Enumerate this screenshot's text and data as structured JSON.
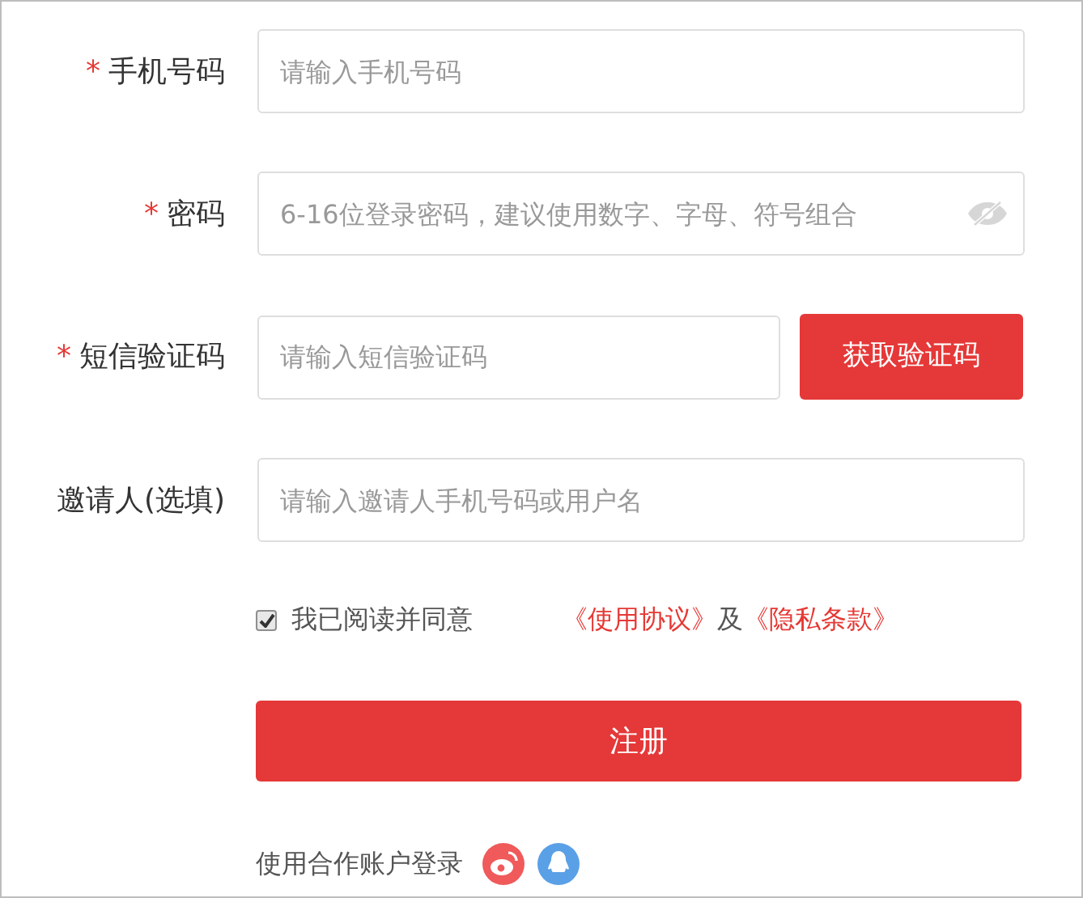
{
  "fields": [
    {
      "label": "手机号码",
      "mark": "*",
      "placeholder": "请输入手机号码",
      "kind": "text"
    },
    {
      "label": "密码",
      "mark": "*",
      "placeholder": "6-16位登录密码，建议使用数字、字母、符号组合",
      "kind": "password"
    },
    {
      "label": "短信验证码",
      "mark": "*",
      "placeholder": "请输入短信验证码",
      "kind": "sms",
      "button": "获取验证码"
    },
    {
      "label": "邀请人(选填)",
      "placeholder": "请输入邀请人手机号码或用户名",
      "kind": "text"
    }
  ],
  "agreement": {
    "checked": true,
    "text": "我已阅读并同意",
    "link_1": "《使用协议》",
    "joiner": "及",
    "link_2": "《隐私条款》"
  },
  "submit": "注册",
  "social_login": {
    "text": "使用合作账户登录"
  }
}
